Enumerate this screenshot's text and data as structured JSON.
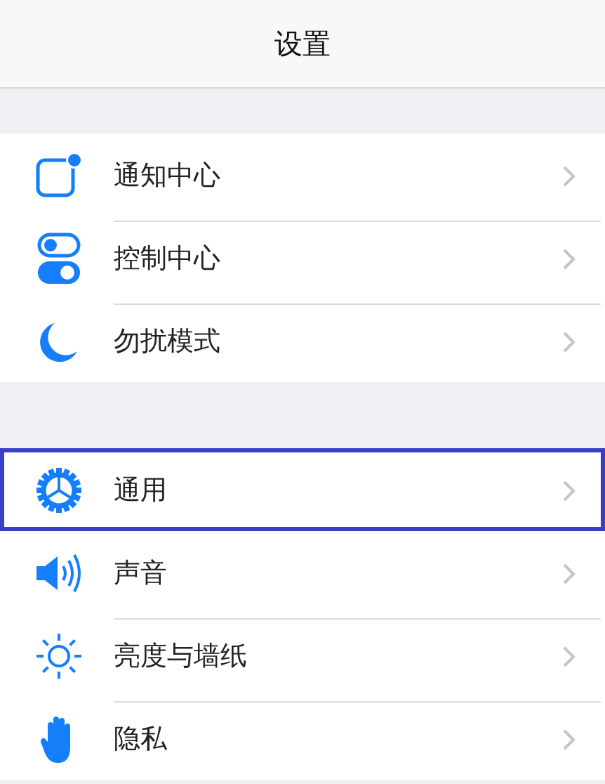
{
  "title": "设置",
  "groups": [
    {
      "items": [
        {
          "kind": "notification",
          "label": "通知中心",
          "highlighted": false
        },
        {
          "kind": "toggles",
          "label": "控制中心",
          "highlighted": false
        },
        {
          "kind": "moon",
          "label": "勿扰模式",
          "highlighted": false
        }
      ]
    },
    {
      "items": [
        {
          "kind": "gear",
          "label": "通用",
          "highlighted": true
        },
        {
          "kind": "speaker",
          "label": "声音",
          "highlighted": false
        },
        {
          "kind": "sun",
          "label": "亮度与墙纸",
          "highlighted": false
        },
        {
          "kind": "hand",
          "label": "隐私",
          "highlighted": false
        }
      ]
    }
  ]
}
